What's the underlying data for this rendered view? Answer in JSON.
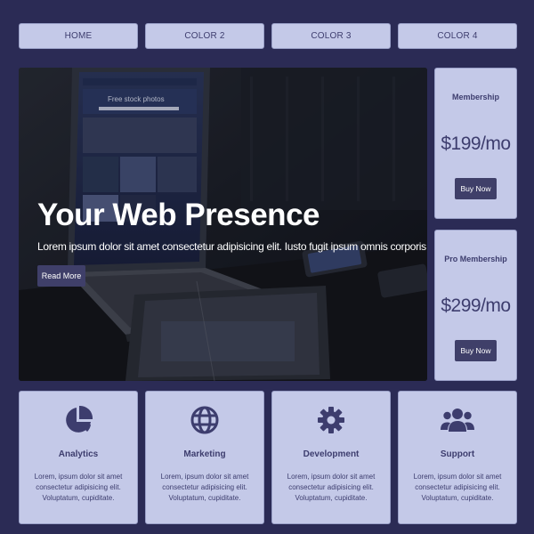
{
  "nav": {
    "items": [
      {
        "label": "HOME"
      },
      {
        "label": "COLOR 2"
      },
      {
        "label": "COLOR 3"
      },
      {
        "label": "COLOR 4"
      }
    ]
  },
  "hero": {
    "title": "Your Web Presence",
    "text": "Lorem ipsum dolor sit amet consectetur adipisicing elit. Iusto fugit ipsum omnis corporis illo doloribus.",
    "button": "Read More",
    "screen_heading": "Free stock photos"
  },
  "pricing": [
    {
      "title": "Membership",
      "price": "$199/mo",
      "button": "Buy Now"
    },
    {
      "title": "Pro Membership",
      "price": "$299/mo",
      "button": "Buy Now"
    }
  ],
  "features": [
    {
      "icon": "pie-chart-icon",
      "title": "Analytics",
      "text": "Lorem, ipsum dolor sit amet consectetur adipisicing elit. Voluptatum, cupiditate."
    },
    {
      "icon": "globe-icon",
      "title": "Marketing",
      "text": "Lorem, ipsum dolor sit amet consectetur adipisicing elit. Voluptatum, cupiditate."
    },
    {
      "icon": "cog-icon",
      "title": "Development",
      "text": "Lorem, ipsum dolor sit amet consectetur adipisicing elit. Voluptatum, cupiditate."
    },
    {
      "icon": "users-icon",
      "title": "Support",
      "text": "Lorem, ipsum dolor sit amet consectetur adipisicing elit. Voluptatum, cupiditate."
    }
  ],
  "colors": {
    "page_bg": "#2b2b55",
    "card_bg": "#c4c9e8",
    "button_bg": "#3f3f69",
    "text_dark": "#3d3d6e"
  }
}
